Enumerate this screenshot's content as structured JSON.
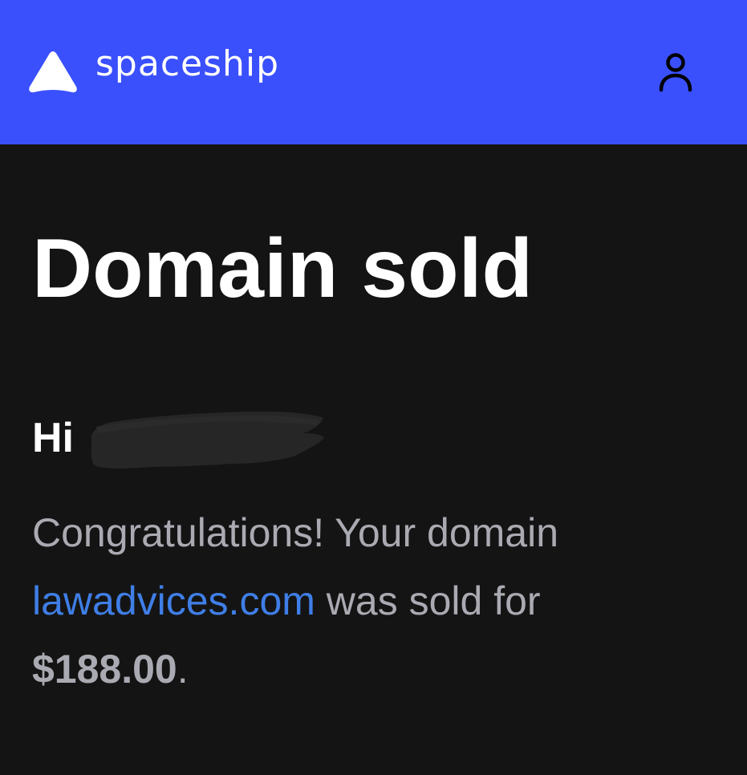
{
  "header": {
    "brand_name": "spaceship",
    "logo_icon": "spaceship-logo-icon",
    "account_icon": "user-icon",
    "background_color": "#3a50fd"
  },
  "email": {
    "title": "Domain sold",
    "greeting_prefix": "Hi ",
    "message_prefix": "Congratulations! Your domain",
    "domain": "lawadvices.com",
    "message_middle": " was sold for",
    "amount": "$188.00",
    "message_suffix": "."
  },
  "colors": {
    "background": "#141414",
    "link": "#3f7ee6",
    "body_text": "#aaaab2"
  }
}
